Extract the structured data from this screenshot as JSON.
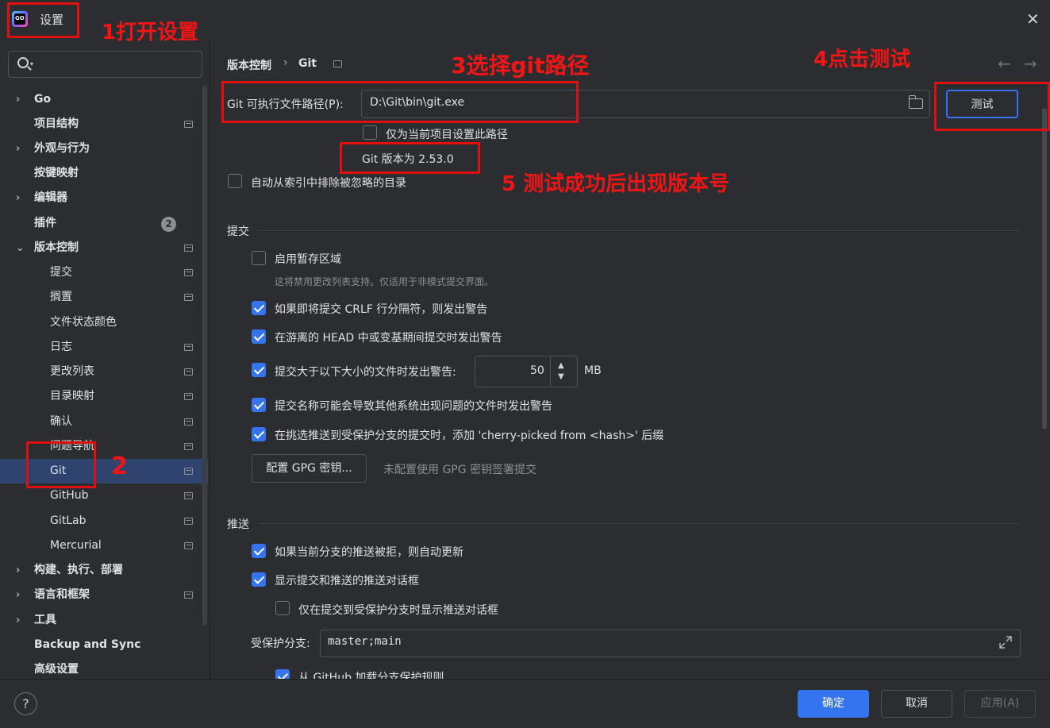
{
  "window": {
    "title": "设置",
    "logo_text": "GO"
  },
  "annotations": {
    "step1": "1打开设置",
    "step2": "2",
    "step3": "3选择git路径",
    "step4": "4点击测试",
    "step5": "5 测试成功后出现版本号"
  },
  "sidebar": {
    "search_placeholder": "",
    "items": [
      {
        "label": "Go",
        "chevron": "›",
        "bold": true
      },
      {
        "label": "项目结构",
        "bold": true
      },
      {
        "label": "外观与行为",
        "chevron": "›",
        "bold": true
      },
      {
        "label": "按键映射",
        "bold": true
      },
      {
        "label": "编辑器",
        "chevron": "›",
        "bold": true
      },
      {
        "label": "插件",
        "bold": true,
        "badge": "2"
      },
      {
        "label": "版本控制",
        "chevron": "⌄",
        "bold": true
      },
      {
        "label": "提交"
      },
      {
        "label": "搁置"
      },
      {
        "label": "文件状态颜色"
      },
      {
        "label": "日志"
      },
      {
        "label": "更改列表"
      },
      {
        "label": "目录映射"
      },
      {
        "label": "确认"
      },
      {
        "label": "问题导航"
      },
      {
        "label": "Git"
      },
      {
        "label": "GitHub"
      },
      {
        "label": "GitLab"
      },
      {
        "label": "Mercurial"
      },
      {
        "label": "构建、执行、部署",
        "chevron": "›",
        "bold": true
      },
      {
        "label": "语言和框架",
        "chevron": "›",
        "bold": true
      },
      {
        "label": "工具",
        "chevron": "›",
        "bold": true
      },
      {
        "label": "Backup and Sync",
        "bold": true
      },
      {
        "label": "高级设置",
        "bold": true
      }
    ]
  },
  "header": {
    "breadcrumb_parent": "版本控制",
    "breadcrumb_sep": "›",
    "breadcrumb_current": "Git",
    "back_arrow": "←",
    "forward_arrow": "→"
  },
  "git": {
    "path_label": "Git 可执行文件路径(P):",
    "path_value": "D:\\Git\\bin\\git.exe",
    "test_button": "测试",
    "project_only_label": "仅为当前项目设置此路径",
    "version_text": "Git 版本为 2.53.0",
    "exclude_ignored_label": "自动从索引中排除被忽略的目录"
  },
  "commit": {
    "section_title": "提交",
    "staging_label": "启用暂存区域",
    "staging_hint": "这将禁用更改列表支持。仅适用于非模式提交界面。",
    "crlf_label": "如果即将提交 CRLF 行分隔符，则发出警告",
    "detached_head_label": "在游离的 HEAD 中或变基期间提交时发出警告",
    "large_file_label": "提交大于以下大小的文件时发出警告:",
    "large_file_value": "50",
    "large_file_unit": "MB",
    "bad_names_label": "提交名称可能会导致其他系统出现问题的文件时发出警告",
    "cherry_pick_label": "在挑选推送到受保护分支的提交时，添加 'cherry-picked from <hash>' 后缀",
    "gpg_button": "配置 GPG 密钥...",
    "gpg_hint": "未配置使用 GPG 密钥签署提交"
  },
  "push": {
    "section_title": "推送",
    "auto_update_label": "如果当前分支的推送被拒，则自动更新",
    "show_dialog_label": "显示提交和推送的推送对话框",
    "protected_only_label": "仅在提交到受保护分支时显示推送对话框",
    "protected_branches_label": "受保护分支:",
    "protected_branches_value": "master;main",
    "github_rules_label": "从 GitHub 加载分支保护规则"
  },
  "footer": {
    "help": "?",
    "ok": "确定",
    "cancel": "取消",
    "apply": "应用(A)"
  },
  "colors": {
    "accent": "#3574f0",
    "annotation": "#e01010",
    "background": "#2b2d30",
    "selection": "#2e436e"
  }
}
